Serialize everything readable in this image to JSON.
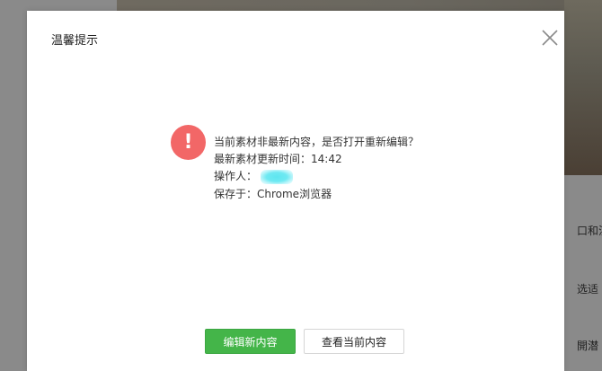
{
  "background": {
    "text_lines": [
      "口和注",
      "选适",
      "開潜"
    ]
  },
  "dialog": {
    "title": "温馨提示",
    "close_label": "×",
    "alert_glyph": "!",
    "message": {
      "line1": "当前素材非最新内容，是否打开重新编辑？",
      "line2": "最新素材更新时间：14:42",
      "operator_label": "操作人：",
      "line4": "保存于：Chrome浏览器"
    },
    "buttons": {
      "edit_new": "编辑新内容",
      "view_current": "查看当前内容"
    }
  },
  "colors": {
    "primary": "#44b549",
    "alert": "#f26767"
  }
}
